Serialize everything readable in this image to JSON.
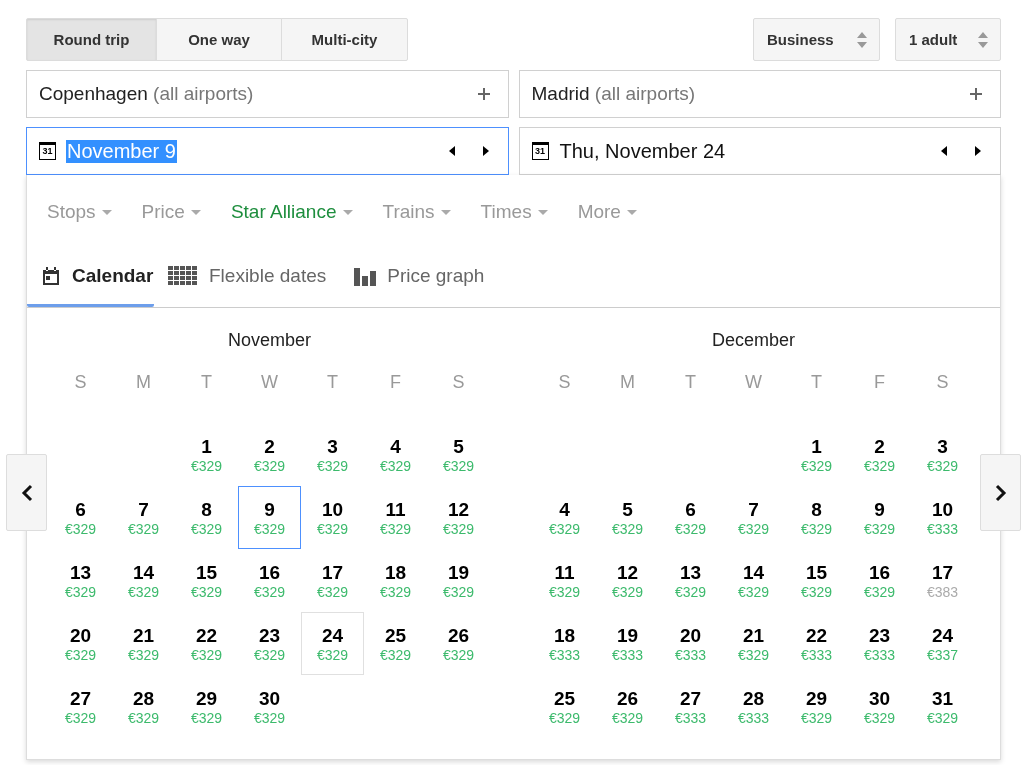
{
  "trip_types": [
    {
      "label": "Round trip",
      "selected": true
    },
    {
      "label": "One way",
      "selected": false
    },
    {
      "label": "Multi-city",
      "selected": false
    }
  ],
  "selects": [
    {
      "value": "Business"
    },
    {
      "value": "1 adult"
    }
  ],
  "places": [
    {
      "name": "Copenhagen",
      "detail": "(all airports)"
    },
    {
      "name": "Madrid",
      "detail": "(all airports)"
    }
  ],
  "dates": [
    {
      "icon_text": "31",
      "value": "November 9",
      "focused": true,
      "text_selected": true
    },
    {
      "icon_text": "31",
      "value": "Thu, November 24",
      "focused": false,
      "text_selected": false
    }
  ],
  "filters": [
    {
      "label": "Stops",
      "active": false
    },
    {
      "label": "Price",
      "active": false
    },
    {
      "label": "Star Alliance",
      "active": true
    },
    {
      "label": "Trains",
      "active": false
    },
    {
      "label": "Times",
      "active": false
    },
    {
      "label": "More",
      "active": false
    }
  ],
  "view_tabs": [
    {
      "kind": "calendar",
      "label": "Calendar",
      "selected": true
    },
    {
      "kind": "grid",
      "label": "Flexible dates",
      "selected": false
    },
    {
      "kind": "bars",
      "label": "Price graph",
      "selected": false
    }
  ],
  "months": [
    {
      "name": "November",
      "weekdays": [
        "S",
        "M",
        "T",
        "W",
        "T",
        "F",
        "S"
      ],
      "weeks": [
        [
          {
            "kind": "blank"
          },
          {
            "kind": "blank"
          },
          {
            "kind": "day",
            "day": "1",
            "price": "€329",
            "cheap": true,
            "selected": false,
            "marked": false
          },
          {
            "kind": "day",
            "day": "2",
            "price": "€329",
            "cheap": true,
            "selected": false,
            "marked": false
          },
          {
            "kind": "day",
            "day": "3",
            "price": "€329",
            "cheap": true,
            "selected": false,
            "marked": false
          },
          {
            "kind": "day",
            "day": "4",
            "price": "€329",
            "cheap": true,
            "selected": false,
            "marked": false
          },
          {
            "kind": "day",
            "day": "5",
            "price": "€329",
            "cheap": true,
            "selected": false,
            "marked": false
          }
        ],
        [
          {
            "kind": "day",
            "day": "6",
            "price": "€329",
            "cheap": true,
            "selected": false,
            "marked": false
          },
          {
            "kind": "day",
            "day": "7",
            "price": "€329",
            "cheap": true,
            "selected": false,
            "marked": false
          },
          {
            "kind": "day",
            "day": "8",
            "price": "€329",
            "cheap": true,
            "selected": false,
            "marked": false
          },
          {
            "kind": "day",
            "day": "9",
            "price": "€329",
            "cheap": true,
            "selected": true,
            "marked": false
          },
          {
            "kind": "day",
            "day": "10",
            "price": "€329",
            "cheap": true,
            "selected": false,
            "marked": false
          },
          {
            "kind": "day",
            "day": "11",
            "price": "€329",
            "cheap": true,
            "selected": false,
            "marked": false
          },
          {
            "kind": "day",
            "day": "12",
            "price": "€329",
            "cheap": true,
            "selected": false,
            "marked": false
          }
        ],
        [
          {
            "kind": "day",
            "day": "13",
            "price": "€329",
            "cheap": true,
            "selected": false,
            "marked": false
          },
          {
            "kind": "day",
            "day": "14",
            "price": "€329",
            "cheap": true,
            "selected": false,
            "marked": false
          },
          {
            "kind": "day",
            "day": "15",
            "price": "€329",
            "cheap": true,
            "selected": false,
            "marked": false
          },
          {
            "kind": "day",
            "day": "16",
            "price": "€329",
            "cheap": true,
            "selected": false,
            "marked": false
          },
          {
            "kind": "day",
            "day": "17",
            "price": "€329",
            "cheap": true,
            "selected": false,
            "marked": false
          },
          {
            "kind": "day",
            "day": "18",
            "price": "€329",
            "cheap": true,
            "selected": false,
            "marked": false
          },
          {
            "kind": "day",
            "day": "19",
            "price": "€329",
            "cheap": true,
            "selected": false,
            "marked": false
          }
        ],
        [
          {
            "kind": "day",
            "day": "20",
            "price": "€329",
            "cheap": true,
            "selected": false,
            "marked": false
          },
          {
            "kind": "day",
            "day": "21",
            "price": "€329",
            "cheap": true,
            "selected": false,
            "marked": false
          },
          {
            "kind": "day",
            "day": "22",
            "price": "€329",
            "cheap": true,
            "selected": false,
            "marked": false
          },
          {
            "kind": "day",
            "day": "23",
            "price": "€329",
            "cheap": true,
            "selected": false,
            "marked": false
          },
          {
            "kind": "day",
            "day": "24",
            "price": "€329",
            "cheap": true,
            "selected": false,
            "marked": true
          },
          {
            "kind": "day",
            "day": "25",
            "price": "€329",
            "cheap": true,
            "selected": false,
            "marked": false
          },
          {
            "kind": "day",
            "day": "26",
            "price": "€329",
            "cheap": true,
            "selected": false,
            "marked": false
          }
        ],
        [
          {
            "kind": "day",
            "day": "27",
            "price": "€329",
            "cheap": true,
            "selected": false,
            "marked": false
          },
          {
            "kind": "day",
            "day": "28",
            "price": "€329",
            "cheap": true,
            "selected": false,
            "marked": false
          },
          {
            "kind": "day",
            "day": "29",
            "price": "€329",
            "cheap": true,
            "selected": false,
            "marked": false
          },
          {
            "kind": "day",
            "day": "30",
            "price": "€329",
            "cheap": true,
            "selected": false,
            "marked": false
          }
        ]
      ]
    },
    {
      "name": "December",
      "weekdays": [
        "S",
        "M",
        "T",
        "W",
        "T",
        "F",
        "S"
      ],
      "weeks": [
        [
          {
            "kind": "blank"
          },
          {
            "kind": "blank"
          },
          {
            "kind": "blank"
          },
          {
            "kind": "blank"
          },
          {
            "kind": "day",
            "day": "1",
            "price": "€329",
            "cheap": true,
            "selected": false,
            "marked": false
          },
          {
            "kind": "day",
            "day": "2",
            "price": "€329",
            "cheap": true,
            "selected": false,
            "marked": false
          },
          {
            "kind": "day",
            "day": "3",
            "price": "€329",
            "cheap": true,
            "selected": false,
            "marked": false
          }
        ],
        [
          {
            "kind": "day",
            "day": "4",
            "price": "€329",
            "cheap": true,
            "selected": false,
            "marked": false
          },
          {
            "kind": "day",
            "day": "5",
            "price": "€329",
            "cheap": true,
            "selected": false,
            "marked": false
          },
          {
            "kind": "day",
            "day": "6",
            "price": "€329",
            "cheap": true,
            "selected": false,
            "marked": false
          },
          {
            "kind": "day",
            "day": "7",
            "price": "€329",
            "cheap": true,
            "selected": false,
            "marked": false
          },
          {
            "kind": "day",
            "day": "8",
            "price": "€329",
            "cheap": true,
            "selected": false,
            "marked": false
          },
          {
            "kind": "day",
            "day": "9",
            "price": "€329",
            "cheap": true,
            "selected": false,
            "marked": false
          },
          {
            "kind": "day",
            "day": "10",
            "price": "€333",
            "cheap": true,
            "selected": false,
            "marked": false
          }
        ],
        [
          {
            "kind": "day",
            "day": "11",
            "price": "€329",
            "cheap": true,
            "selected": false,
            "marked": false
          },
          {
            "kind": "day",
            "day": "12",
            "price": "€329",
            "cheap": true,
            "selected": false,
            "marked": false
          },
          {
            "kind": "day",
            "day": "13",
            "price": "€329",
            "cheap": true,
            "selected": false,
            "marked": false
          },
          {
            "kind": "day",
            "day": "14",
            "price": "€329",
            "cheap": true,
            "selected": false,
            "marked": false
          },
          {
            "kind": "day",
            "day": "15",
            "price": "€329",
            "cheap": true,
            "selected": false,
            "marked": false
          },
          {
            "kind": "day",
            "day": "16",
            "price": "€329",
            "cheap": true,
            "selected": false,
            "marked": false
          },
          {
            "kind": "day",
            "day": "17",
            "price": "€383",
            "cheap": false,
            "selected": false,
            "marked": false
          }
        ],
        [
          {
            "kind": "day",
            "day": "18",
            "price": "€333",
            "cheap": true,
            "selected": false,
            "marked": false
          },
          {
            "kind": "day",
            "day": "19",
            "price": "€333",
            "cheap": true,
            "selected": false,
            "marked": false
          },
          {
            "kind": "day",
            "day": "20",
            "price": "€333",
            "cheap": true,
            "selected": false,
            "marked": false
          },
          {
            "kind": "day",
            "day": "21",
            "price": "€329",
            "cheap": true,
            "selected": false,
            "marked": false
          },
          {
            "kind": "day",
            "day": "22",
            "price": "€333",
            "cheap": true,
            "selected": false,
            "marked": false
          },
          {
            "kind": "day",
            "day": "23",
            "price": "€333",
            "cheap": true,
            "selected": false,
            "marked": false
          },
          {
            "kind": "day",
            "day": "24",
            "price": "€337",
            "cheap": true,
            "selected": false,
            "marked": false
          }
        ],
        [
          {
            "kind": "day",
            "day": "25",
            "price": "€329",
            "cheap": true,
            "selected": false,
            "marked": false
          },
          {
            "kind": "day",
            "day": "26",
            "price": "€329",
            "cheap": true,
            "selected": false,
            "marked": false
          },
          {
            "kind": "day",
            "day": "27",
            "price": "€333",
            "cheap": true,
            "selected": false,
            "marked": false
          },
          {
            "kind": "day",
            "day": "28",
            "price": "€333",
            "cheap": true,
            "selected": false,
            "marked": false
          },
          {
            "kind": "day",
            "day": "29",
            "price": "€329",
            "cheap": true,
            "selected": false,
            "marked": false
          },
          {
            "kind": "day",
            "day": "30",
            "price": "€329",
            "cheap": true,
            "selected": false,
            "marked": false
          },
          {
            "kind": "day",
            "day": "31",
            "price": "€329",
            "cheap": true,
            "selected": false,
            "marked": false
          }
        ]
      ]
    }
  ]
}
